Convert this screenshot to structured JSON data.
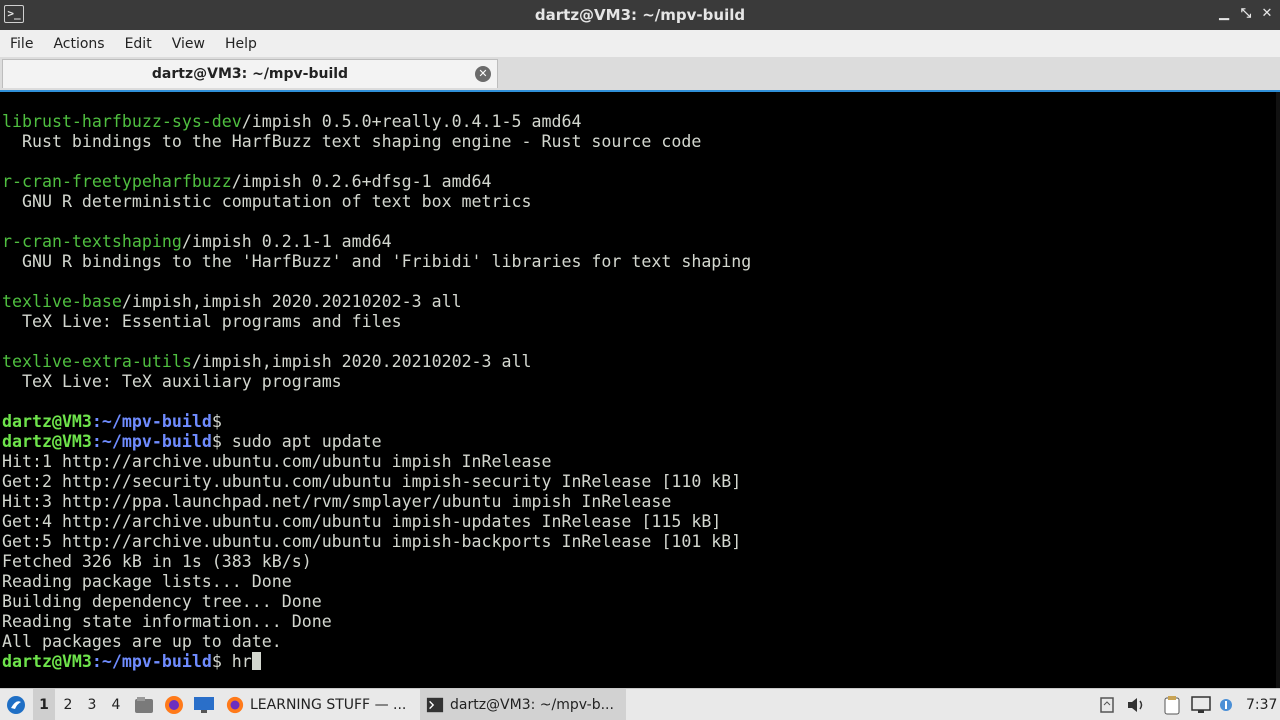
{
  "window": {
    "title": "dartz@VM3: ~/mpv-build",
    "app_icon": ">_",
    "controls": {
      "minimize": "▁",
      "maximize": "⤡",
      "close": "✕"
    }
  },
  "menu": [
    "File",
    "Actions",
    "Edit",
    "View",
    "Help"
  ],
  "tab": {
    "label": "dartz@VM3: ~/mpv-build",
    "close": "✕"
  },
  "terminal": {
    "prompt_user": "dartz@VM3",
    "prompt_path": ":~/mpv-build",
    "prompt_dollar": "$",
    "lines": [
      {
        "pkg": "librust-harfbuzz-sys-dev",
        "rest": "/impish 0.5.0+really.0.4.1-5 amd64"
      },
      {
        "text": "  Rust bindings to the HarfBuzz text shaping engine - Rust source code"
      },
      {
        "text": ""
      },
      {
        "pkg": "r-cran-freetypeharfbuzz",
        "rest": "/impish 0.2.6+dfsg-1 amd64"
      },
      {
        "text": "  GNU R deterministic computation of text box metrics"
      },
      {
        "text": ""
      },
      {
        "pkg": "r-cran-textshaping",
        "rest": "/impish 0.2.1-1 amd64"
      },
      {
        "text": "  GNU R bindings to the 'HarfBuzz' and 'Fribidi' libraries for text shaping"
      },
      {
        "text": ""
      },
      {
        "pkg": "texlive-base",
        "rest": "/impish,impish 2020.20210202-3 all"
      },
      {
        "text": "  TeX Live: Essential programs and files"
      },
      {
        "text": ""
      },
      {
        "pkg": "texlive-extra-utils",
        "rest": "/impish,impish 2020.20210202-3 all"
      },
      {
        "text": "  TeX Live: TeX auxiliary programs"
      },
      {
        "text": ""
      },
      {
        "prompt": true,
        "cmd": ""
      },
      {
        "prompt": true,
        "cmd": " sudo apt update"
      },
      {
        "text": "Hit:1 http://archive.ubuntu.com/ubuntu impish InRelease"
      },
      {
        "text": "Get:2 http://security.ubuntu.com/ubuntu impish-security InRelease [110 kB]"
      },
      {
        "text": "Hit:3 http://ppa.launchpad.net/rvm/smplayer/ubuntu impish InRelease"
      },
      {
        "text": "Get:4 http://archive.ubuntu.com/ubuntu impish-updates InRelease [115 kB]"
      },
      {
        "text": "Get:5 http://archive.ubuntu.com/ubuntu impish-backports InRelease [101 kB]"
      },
      {
        "text": "Fetched 326 kB in 1s (383 kB/s)"
      },
      {
        "text": "Reading package lists... Done"
      },
      {
        "text": "Building dependency tree... Done"
      },
      {
        "text": "Reading state information... Done"
      },
      {
        "text": "All packages are up to date."
      },
      {
        "prompt": true,
        "cmd": " hr",
        "cursor": true
      }
    ]
  },
  "taskbar": {
    "workspaces": [
      "1",
      "2",
      "3",
      "4"
    ],
    "active_workspace": "1",
    "windows": [
      {
        "label": "LEARNING STUFF — ...",
        "icon": "firefox-icon"
      },
      {
        "label": "dartz@VM3: ~/mpv-b...",
        "icon": "terminal-icon"
      }
    ],
    "clock": "7:37"
  },
  "colors": {
    "terminal_bg": "#000000",
    "package_green": "#4fbf40",
    "prompt_user_green": "#6ee44b",
    "prompt_path_blue": "#6f8cff",
    "accent": "#2f8fd8"
  }
}
